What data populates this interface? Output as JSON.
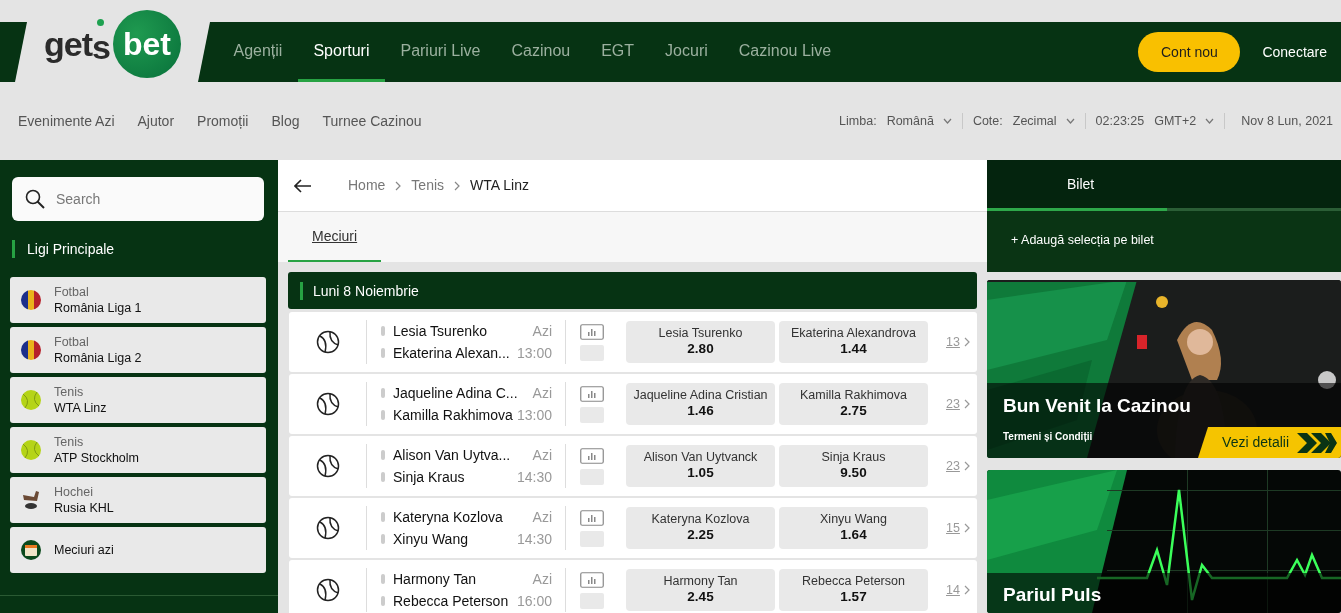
{
  "header": {
    "logo": {
      "part1": "get",
      "part2": "s",
      "part3": "bet"
    },
    "nav": [
      {
        "label": "Agenții",
        "selected": false
      },
      {
        "label": "Sporturi",
        "selected": true
      },
      {
        "label": "Pariuri Live",
        "selected": false
      },
      {
        "label": "Cazinou",
        "selected": false
      },
      {
        "label": "EGT",
        "selected": false
      },
      {
        "label": "Jocuri",
        "selected": false
      },
      {
        "label": "Cazinou Live",
        "selected": false
      }
    ],
    "signup": "Cont nou",
    "login": "Conectare"
  },
  "subbar": {
    "links": [
      "Evenimente Azi",
      "Ajutor",
      "Promoții",
      "Blog",
      "Turnee Cazinou"
    ],
    "settings": [
      {
        "label": "Limba:",
        "value": "Română",
        "dropdown": true
      },
      {
        "label": "Cote:",
        "value": "Zecimal",
        "dropdown": true
      },
      {
        "label": "02:23:25",
        "value": "GMT+2",
        "dropdown": true
      },
      {
        "value": "Nov 8 Lun, 2021",
        "dropdown": false
      }
    ]
  },
  "sidebar": {
    "search": {
      "placeholder": "Search"
    },
    "section": "Ligi Principale",
    "items": [
      {
        "kind": "romania",
        "sport": "Fotbal",
        "league": "România Liga 1"
      },
      {
        "kind": "romania",
        "sport": "Fotbal",
        "league": "România Liga 2"
      },
      {
        "kind": "tennis",
        "sport": "Tenis",
        "league": "WTA Linz"
      },
      {
        "kind": "tennis",
        "sport": "Tenis",
        "league": "ATP Stockholm"
      },
      {
        "kind": "hockey",
        "sport": "Hochei",
        "league": "Rusia KHL"
      },
      {
        "kind": "calendar",
        "league": "Meciuri azi"
      }
    ]
  },
  "center": {
    "breadcrumb": [
      "Home",
      "Tenis",
      "WTA Linz"
    ],
    "tabs": [
      {
        "label": "Meciuri",
        "selected": true
      }
    ],
    "day_header": "Luni 8 Noiembrie",
    "matches": [
      {
        "players": [
          "Lesia Tsurenko",
          "Ekaterina Alexan..."
        ],
        "day": "Azi",
        "time": "13:00",
        "odds": [
          {
            "name": "Lesia Tsurenko",
            "value": "2.80"
          },
          {
            "name": "Ekaterina Alexandrova",
            "value": "1.44"
          }
        ],
        "markets": "13"
      },
      {
        "players": [
          "Jaqueline Adina C...",
          "Kamilla Rakhimova"
        ],
        "day": "Azi",
        "time": "13:00",
        "odds": [
          {
            "name": "Jaqueline Adina Cristian",
            "value": "1.46"
          },
          {
            "name": "Kamilla Rakhimova",
            "value": "2.75"
          }
        ],
        "markets": "23"
      },
      {
        "players": [
          "Alison Van Uytva...",
          "Sinja Kraus"
        ],
        "day": "Azi",
        "time": "14:30",
        "odds": [
          {
            "name": "Alison Van Uytvanck",
            "value": "1.05"
          },
          {
            "name": "Sinja Kraus",
            "value": "9.50"
          }
        ],
        "markets": "23"
      },
      {
        "players": [
          "Kateryna Kozlova",
          "Xinyu Wang"
        ],
        "day": "Azi",
        "time": "14:30",
        "odds": [
          {
            "name": "Kateryna Kozlova",
            "value": "2.25"
          },
          {
            "name": "Xinyu Wang",
            "value": "1.64"
          }
        ],
        "markets": "15"
      },
      {
        "players": [
          "Harmony Tan",
          "Rebecca Peterson"
        ],
        "day": "Azi",
        "time": "16:00",
        "odds": [
          {
            "name": "Harmony Tan",
            "value": "2.45"
          },
          {
            "name": "Rebecca Peterson",
            "value": "1.57"
          }
        ],
        "markets": "14"
      }
    ]
  },
  "right": {
    "betslip": {
      "tab": "Bilet",
      "add": "+ Adaugă selecția pe bilet"
    },
    "banners": [
      {
        "kind": "casino",
        "title": "Bun Venit la Cazinou",
        "terms": "Termeni și Condiții",
        "cta": "Vezi detalii"
      },
      {
        "kind": "pulse",
        "title": "Pariul Puls"
      }
    ]
  }
}
